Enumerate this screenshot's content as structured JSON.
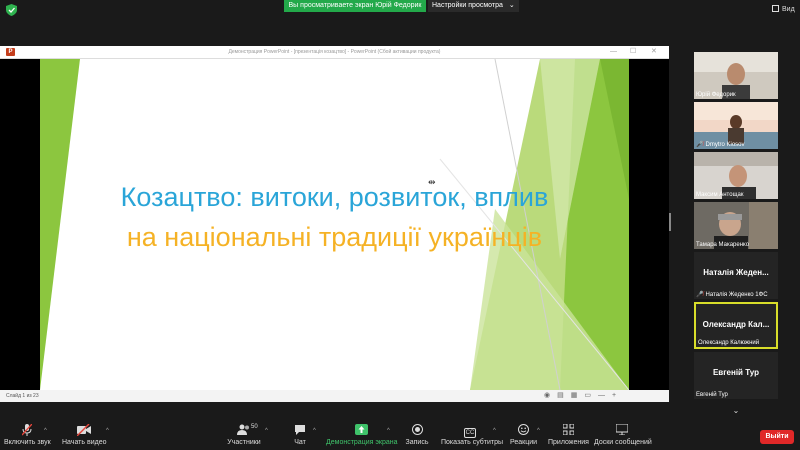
{
  "topbar": {
    "share_banner": "Вы просматриваете экран Юрій Федорик",
    "share_settings": "Настройки просмотра",
    "settings_chevron": "⌄",
    "view_label": "Вид"
  },
  "window": {
    "title": "Демонстрация PowerPoint - [презентація козацтво] - PowerPoint (Сбой активации продукта)",
    "logo_letter": "P",
    "minimize": "—",
    "maximize": "☐",
    "close": "✕"
  },
  "slide": {
    "title_line1": "Козацтво: витоки, розвиток, вплив",
    "title_line2": "на національні традиції українців",
    "title_line1_color": "#2aa5d8",
    "title_line2_color": "#f5b225",
    "accent_green": "#8cc63f"
  },
  "status": {
    "slide_counter": "Слайд 1 из 23",
    "icons": [
      "◉",
      "▤",
      "▦",
      "▭",
      "—",
      "+"
    ]
  },
  "participants": [
    {
      "name": "Юрій Федорик",
      "type": "video",
      "muted": false
    },
    {
      "name": "Dmytro Kiosov",
      "type": "video",
      "muted": true
    },
    {
      "name": "Максим Антощак",
      "type": "video",
      "muted": false
    },
    {
      "name": "Тамара Макаренко",
      "type": "video",
      "muted": false
    },
    {
      "name": "Наталія Жеденко 1ФС",
      "display": "Наталія Жеден...",
      "type": "name",
      "muted": true
    },
    {
      "name": "Олександр Калюжний",
      "display": "Олександр Кал...",
      "type": "name",
      "muted": false,
      "active": true
    },
    {
      "name": "Евгеній Тур",
      "display": "Евгеній Тур",
      "type": "name",
      "muted": false
    }
  ],
  "toolbar": {
    "unmute": "Включить звук",
    "start_video": "Начать видео",
    "participants": "Участники",
    "participants_count": "50",
    "chat": "Чат",
    "share": "Демонстрация экрана",
    "record": "Запись",
    "subtitles": "Показать субтитры",
    "subtitles_icon": "CC",
    "reactions": "Реакции",
    "apps": "Приложения",
    "whiteboard": "Доски сообщений",
    "leave": "Выйти",
    "caret": "^"
  }
}
